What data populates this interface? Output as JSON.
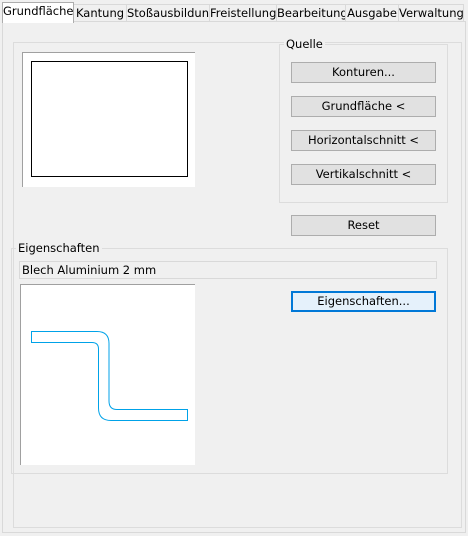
{
  "tabs": [
    {
      "label": "Grundfläche",
      "active": true
    },
    {
      "label": "Kantung"
    },
    {
      "label": "Stoßausbildung"
    },
    {
      "label": "Freistellung"
    },
    {
      "label": "Bearbeitung"
    },
    {
      "label": "Ausgabe"
    },
    {
      "label": "Verwaltung"
    }
  ],
  "quelle": {
    "legend": "Quelle",
    "buttons": {
      "konturen": "Konturen...",
      "grundflaeche": "Grundfläche <",
      "horizontalschnitt": "Horizontalschnitt <",
      "vertikalschnitt": "Vertikalschnitt <"
    }
  },
  "reset_label": "Reset",
  "eigenschaften": {
    "legend": "Eigenschaften",
    "material": "Blech Aluminium 2 mm",
    "button_label": "Eigenschaften..."
  },
  "colors": {
    "profile_stroke": "#00a2e8",
    "focus_border": "#0078d7"
  }
}
